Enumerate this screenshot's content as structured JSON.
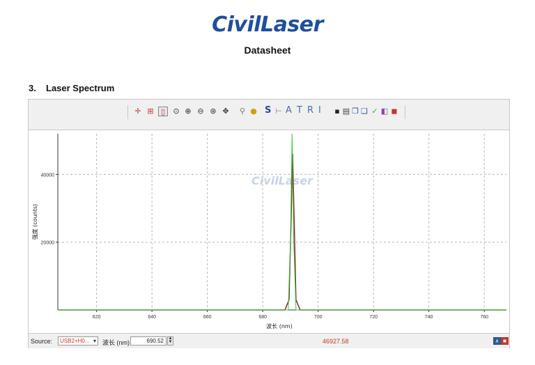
{
  "header": {
    "logo_text": "CivilLaser",
    "doc_title": "Datasheet"
  },
  "section": {
    "number": "3.",
    "title": "Laser Spectrum"
  },
  "toolbar": {
    "icons": [
      "crosshair-icon",
      "grid-icon",
      "fit-icon",
      "zoom-icon",
      "zoom-in-icon",
      "zoom-out-icon",
      "zoom-reset-icon",
      "pan-icon",
      "pin-icon",
      "bulb-icon",
      "s-tool-icon",
      "marker-icon",
      "text-tool-icon",
      "t-tool-icon",
      "r-tool-icon",
      "i-tool-icon",
      "save-icon",
      "print-icon",
      "copy-icon",
      "paste-icon",
      "export-icon",
      "settings-icon",
      "image-icon"
    ],
    "text_tools": [
      "S",
      "A",
      "T",
      "R",
      "I"
    ]
  },
  "chart_data": {
    "type": "line",
    "xlabel": "波长 (nm)",
    "ylabel": "强度 (counts)",
    "watermark": "CivilLaser",
    "xlim": [
      606,
      768
    ],
    "ylim": [
      0,
      52000
    ],
    "xticks": [
      620,
      640,
      660,
      680,
      700,
      720,
      740,
      760
    ],
    "yticks": [
      20000,
      40000
    ],
    "grid": true,
    "series": [
      {
        "color": "#8b1a1a",
        "x": [
          606,
          688,
          689.5,
          690.3,
          690.8,
          691.3,
          692.0,
          693.5,
          768
        ],
        "y": [
          0,
          0,
          3000,
          28000,
          46000,
          28000,
          3000,
          0,
          0
        ]
      },
      {
        "color": "#2ecc40",
        "x": [
          606,
          689.2,
          690.0,
          690.6,
          691.2,
          692.0,
          768
        ],
        "y": [
          0,
          0,
          20000,
          52000,
          20000,
          0,
          0
        ]
      }
    ]
  },
  "status": {
    "source_label": "Source:",
    "source_value": "USB2+H0...",
    "wavelength_label": "波长 (nm):",
    "wavelength_value": "690.52",
    "intensity_value": "46927.58"
  }
}
